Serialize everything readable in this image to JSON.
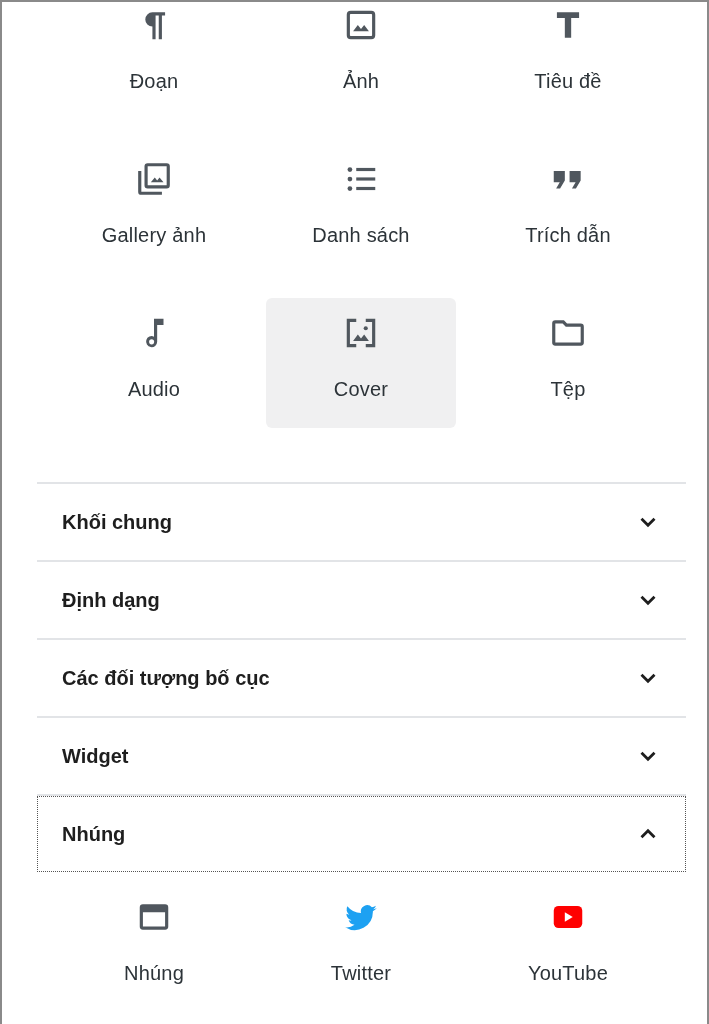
{
  "blocks": [
    {
      "label": "Đoạn",
      "kind": "paragraph",
      "selected": false
    },
    {
      "label": "Ảnh",
      "kind": "image",
      "selected": false
    },
    {
      "label": "Tiêu đề",
      "kind": "heading",
      "selected": false
    },
    {
      "label": "Gallery ảnh",
      "kind": "gallery",
      "selected": false
    },
    {
      "label": "Danh sách",
      "kind": "list",
      "selected": false
    },
    {
      "label": "Trích dẫn",
      "kind": "quote",
      "selected": false
    },
    {
      "label": "Audio",
      "kind": "audio",
      "selected": false
    },
    {
      "label": "Cover",
      "kind": "cover",
      "selected": true
    },
    {
      "label": "Tệp",
      "kind": "file",
      "selected": false
    }
  ],
  "sections": [
    {
      "title": "Khối chung",
      "expanded": false,
      "focused": false
    },
    {
      "title": "Định dạng",
      "expanded": false,
      "focused": false
    },
    {
      "title": "Các đối tượng bố cục",
      "expanded": false,
      "focused": false
    },
    {
      "title": "Widget",
      "expanded": false,
      "focused": false
    },
    {
      "title": "Nhúng",
      "expanded": true,
      "focused": true,
      "items": [
        {
          "label": "Nhúng",
          "kind": "embed",
          "selected": false
        },
        {
          "label": "Twitter",
          "kind": "twitter",
          "selected": false
        },
        {
          "label": "YouTube",
          "kind": "youtube",
          "selected": false
        }
      ]
    }
  ]
}
